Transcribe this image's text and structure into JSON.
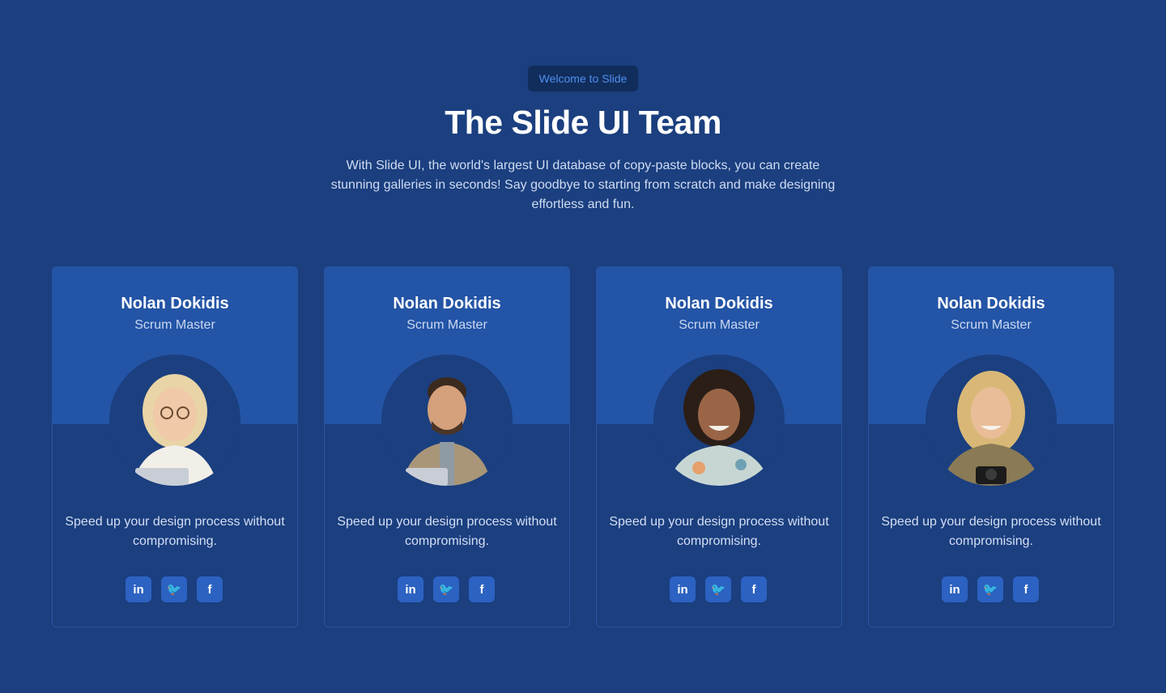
{
  "header": {
    "badge": "Welcome to Slide",
    "title": "The Slide UI Team",
    "subtitle": "With Slide UI, the world's largest UI database of copy-paste blocks, you can create stunning galleries in seconds! Say goodbye to starting from scratch and make designing effortless and fun."
  },
  "colors": {
    "page_background": "#1b3f7f",
    "card_top": "#2354a6",
    "social_button": "#2c62c2",
    "badge_text": "#4f8ff0"
  },
  "cards": [
    {
      "name": "Nolan Dokidis",
      "role": "Scrum Master",
      "description": "Speed up your design process without compromising.",
      "socials": [
        {
          "icon": "linkedin-icon",
          "label": "in"
        },
        {
          "icon": "twitter-icon",
          "label": "🐦"
        },
        {
          "icon": "facebook-icon",
          "label": "f"
        }
      ]
    },
    {
      "name": "Nolan Dokidis",
      "role": "Scrum Master",
      "description": "Speed up your design process without compromising.",
      "socials": [
        {
          "icon": "linkedin-icon",
          "label": "in"
        },
        {
          "icon": "twitter-icon",
          "label": "🐦"
        },
        {
          "icon": "facebook-icon",
          "label": "f"
        }
      ]
    },
    {
      "name": "Nolan Dokidis",
      "role": "Scrum Master",
      "description": "Speed up your design process without compromising.",
      "socials": [
        {
          "icon": "linkedin-icon",
          "label": "in"
        },
        {
          "icon": "twitter-icon",
          "label": "🐦"
        },
        {
          "icon": "facebook-icon",
          "label": "f"
        }
      ]
    },
    {
      "name": "Nolan Dokidis",
      "role": "Scrum Master",
      "description": "Speed up your design process without compromising.",
      "socials": [
        {
          "icon": "linkedin-icon",
          "label": "in"
        },
        {
          "icon": "twitter-icon",
          "label": "🐦"
        },
        {
          "icon": "facebook-icon",
          "label": "f"
        }
      ]
    }
  ]
}
